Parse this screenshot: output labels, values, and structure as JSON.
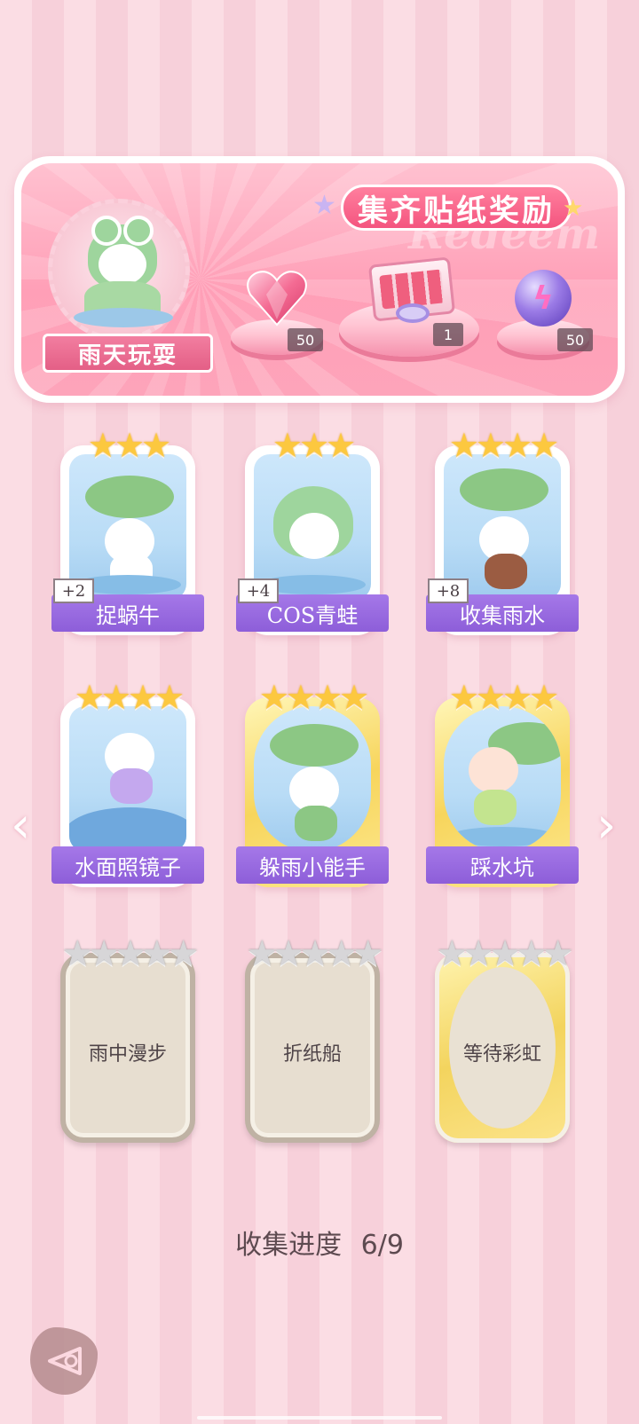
{
  "banner": {
    "title": "集齐贴纸奖励",
    "watermark": "Redeem",
    "label": "雨天玩耍",
    "rewards": [
      {
        "icon": "pink-heart-gem-icon",
        "qty": "50"
      },
      {
        "icon": "gift-box-icon",
        "qty": "1"
      },
      {
        "icon": "purple-energy-orb-icon",
        "qty": "50"
      }
    ]
  },
  "cards": [
    {
      "label": "捉蜗牛",
      "stars": "★★★",
      "bonus": "+2"
    },
    {
      "label": "COS青蛙",
      "stars": "★★★",
      "bonus": "+4"
    },
    {
      "label": "收集雨水",
      "stars": "★★★★",
      "bonus": "+8"
    },
    {
      "label": "水面照镜子",
      "stars": "★★★★"
    },
    {
      "label": "躲雨小能手",
      "stars": "★★★★"
    },
    {
      "label": "踩水坑",
      "stars": "★★★★"
    },
    {
      "label": "雨中漫步",
      "stars": "★★★★★"
    },
    {
      "label": "折纸船",
      "stars": "★★★★★"
    },
    {
      "label": "等待彩虹",
      "stars": "★★★★★"
    }
  ],
  "nav": {
    "prev": "‹",
    "next": "›"
  },
  "progress": {
    "label": "收集进度",
    "value": "6/9"
  },
  "colors": {
    "accent_pink": "#f4557f",
    "label_purple": "#8d5ed9",
    "star_gold": "#fcc83f"
  }
}
